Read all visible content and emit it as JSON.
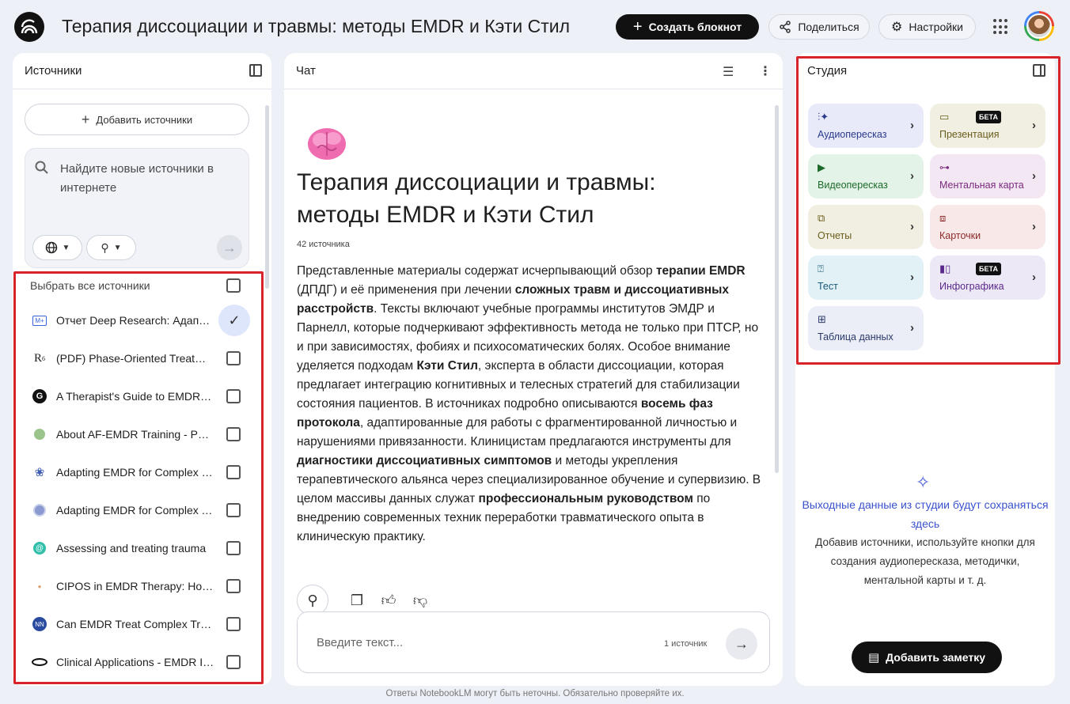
{
  "header": {
    "title": "Терапия диссоциации и травмы: методы EMDR и Кэти Стил",
    "create_label": "Создать блокнот",
    "share_label": "Поделиться",
    "settings_label": "Настройки"
  },
  "sources": {
    "title": "Источники",
    "add_label": "Добавить источники",
    "search_placeholder": "Найдите новые источники в интернете",
    "select_all_label": "Выбрать все источники",
    "items": [
      {
        "label": "Отчет Deep Research: Адаптация EMDR",
        "icon": "M+",
        "checked": true
      },
      {
        "label": "(PDF) Phase-Oriented Treatment",
        "icon": "R⁶",
        "checked": false
      },
      {
        "label": "A Therapist's Guide to EMDR - Psychology",
        "icon": "G",
        "checked": false
      },
      {
        "label": "About AF-EMDR Training - Parnell",
        "icon": "tree",
        "checked": false
      },
      {
        "label": "Adapting EMDR for Complex PTSD",
        "icon": "lotus",
        "checked": false
      },
      {
        "label": "Adapting EMDR for Complex Trauma",
        "icon": "globe",
        "checked": false
      },
      {
        "label": "Assessing and treating trauma",
        "icon": "swirl",
        "checked": false
      },
      {
        "label": "CIPOS in EMDR Therapy: How it works",
        "icon": "dot",
        "checked": false
      },
      {
        "label": "Can EMDR Treat Complex Trauma",
        "icon": "NN",
        "checked": false
      },
      {
        "label": "Clinical Applications - EMDR Institute",
        "icon": "eye",
        "checked": false
      }
    ]
  },
  "chat": {
    "title": "Чат",
    "notebook_title": "Терапия диссоциации и травмы: методы EMDR и Кэти Стил",
    "source_count": "42 источника",
    "summary_parts": [
      {
        "t": "Представленные материалы содержат исчерпывающий обзор ",
        "b": false
      },
      {
        "t": "терапии EMDR",
        "b": true
      },
      {
        "t": " (ДПДГ) и её применения при лечении ",
        "b": false
      },
      {
        "t": "сложных травм и диссоциативных расстройств",
        "b": true
      },
      {
        "t": ". Тексты включают учебные программы институтов ЭМДР и Парнелл, которые подчеркивают эффективность метода не только при ПТСР, но и при зависимостях, фобиях и психосоматических болях. Особое внимание уделяется подходам ",
        "b": false
      },
      {
        "t": "Кэти Стил",
        "b": true
      },
      {
        "t": ", эксперта в области диссоциации, которая предлагает интеграцию когнитивных и телесных стратегий для стабилизации состояния пациентов. В источниках подробно описываются ",
        "b": false
      },
      {
        "t": "восемь фаз протокола",
        "b": true
      },
      {
        "t": ", адаптированные для работы с фрагментированной личностью и нарушениями привязанности. Клиницистам предлагаются инструменты для ",
        "b": false
      },
      {
        "t": "диагностики диссоциативных симптомов",
        "b": true
      },
      {
        "t": " и методы укрепления терапевтического альянса через специализированное обучение и супервизию. В целом массивы данных служат ",
        "b": false
      },
      {
        "t": "профессиональным руководством",
        "b": true
      },
      {
        "t": " по внедрению современных техник переработки травматического опыта в клиническую практику.",
        "b": false
      }
    ],
    "composer_placeholder": "Введите текст...",
    "composer_source_count": "1 источник"
  },
  "studio": {
    "title": "Студия",
    "tiles": [
      {
        "label": "Аудиопересказ",
        "icon": "audio-icon",
        "beta": false
      },
      {
        "label": "Презентация",
        "icon": "slides-icon",
        "beta": true
      },
      {
        "label": "Видеопересказ",
        "icon": "video-icon",
        "beta": false
      },
      {
        "label": "Ментальная карта",
        "icon": "mindmap-icon",
        "beta": false
      },
      {
        "label": "Отчеты",
        "icon": "report-icon",
        "beta": false
      },
      {
        "label": "Карточки",
        "icon": "cards-icon",
        "beta": false
      },
      {
        "label": "Тест",
        "icon": "quiz-icon",
        "beta": false
      },
      {
        "label": "Инфографика",
        "icon": "infographic-icon",
        "beta": true
      },
      {
        "label": "Таблица данных",
        "icon": "table-icon",
        "beta": false
      }
    ],
    "beta_label": "БЕТА",
    "empty_title": "Выходные данные из студии будут сохраняться здесь",
    "empty_desc": "Добавив источники, используйте кнопки для создания аудиопересказа, методички, ментальной карты и т. д.",
    "add_note_label": "Добавить заметку"
  },
  "footer": {
    "disclaimer": "Ответы NotebookLM могут быть неточны. Обязательно проверяйте их."
  }
}
